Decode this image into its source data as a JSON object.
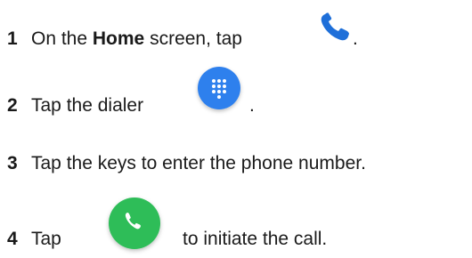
{
  "steps": [
    {
      "number": "1",
      "before": "On the ",
      "bold": "Home",
      "after": " screen, tap ",
      "end": "."
    },
    {
      "number": "2",
      "before": "Tap the dialer ",
      "end": "."
    },
    {
      "number": "3",
      "text": "Tap the keys to enter the phone number."
    },
    {
      "number": "4",
      "before": "Tap ",
      "after": "to initiate the call."
    }
  ],
  "icons": {
    "phone": "phone-icon",
    "dialer": "dialpad-icon",
    "call": "call-button-icon"
  },
  "colors": {
    "phone_blue": "#1e6fd9",
    "dialer_blue": "#2f80ed",
    "call_green": "#2ebd59"
  }
}
